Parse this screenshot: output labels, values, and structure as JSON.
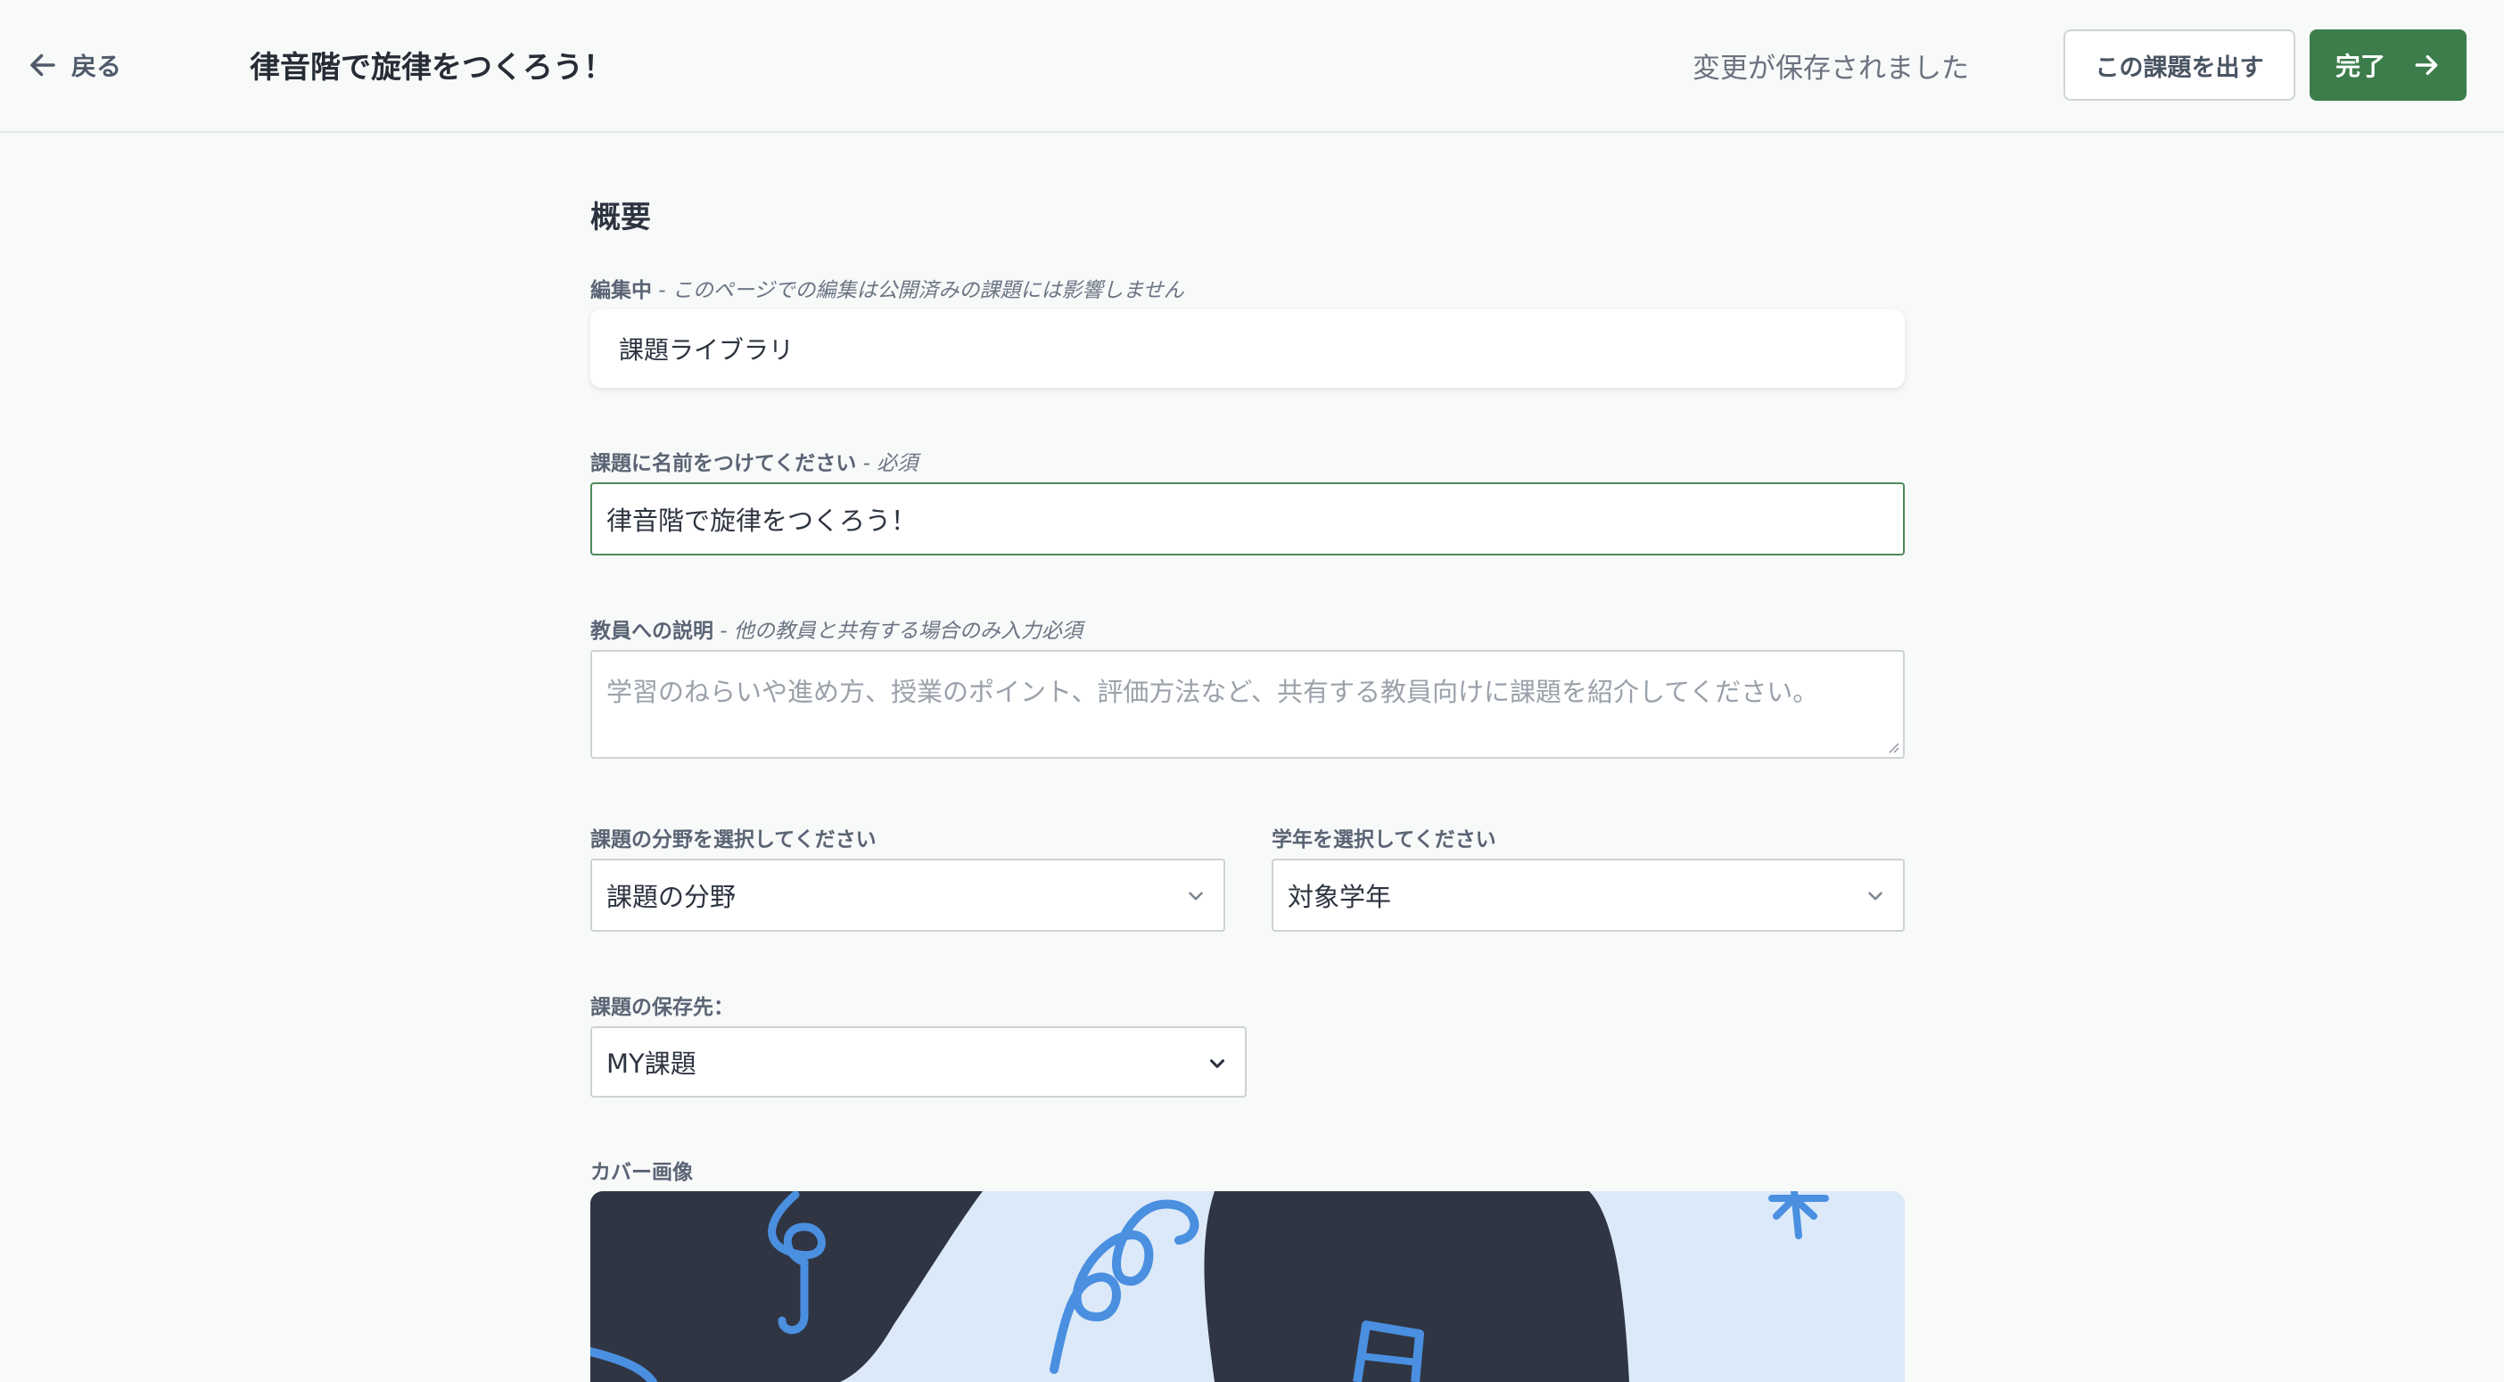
{
  "header": {
    "back_label": "戻る",
    "title": "律音階で旋律をつくろう！",
    "saved_status": "変更が保存されました",
    "assign_button": "この課題を出す",
    "done_button": "完了"
  },
  "overview": {
    "section_title": "概要",
    "editing": {
      "label": "編集中",
      "note": " - このページでの編集は公開済みの課題には影響しません",
      "value": "課題ライブラリ"
    },
    "name": {
      "label": "課題に名前をつけてください",
      "note": " - 必須",
      "value": "律音階で旋律をつくろう！"
    },
    "teacher_description": {
      "label": "教員への説明",
      "note": " - 他の教員と共有する場合のみ入力必須",
      "placeholder": "学習のねらいや進め方、授業のポイント、評価方法など、共有する教員向けに課題を紹介してください。"
    },
    "field": {
      "label": "課題の分野を選択してください",
      "value": "課題の分野"
    },
    "grade": {
      "label": "学年を選択してください",
      "value": "対象学年"
    },
    "save_location": {
      "label": "課題の保存先：",
      "value": "MY課題"
    },
    "cover_image": {
      "label": "カバー画像"
    }
  },
  "icons": {
    "back": "arrow-left-icon",
    "done": "arrow-right-icon",
    "dropdown": "chevron-down-icon"
  },
  "colors": {
    "primary": "#3c7d4b",
    "background": "#f8f9f9",
    "cover_dark": "#2f3542",
    "cover_light": "#dce9f8",
    "cover_accent": "#4a8fe0"
  }
}
